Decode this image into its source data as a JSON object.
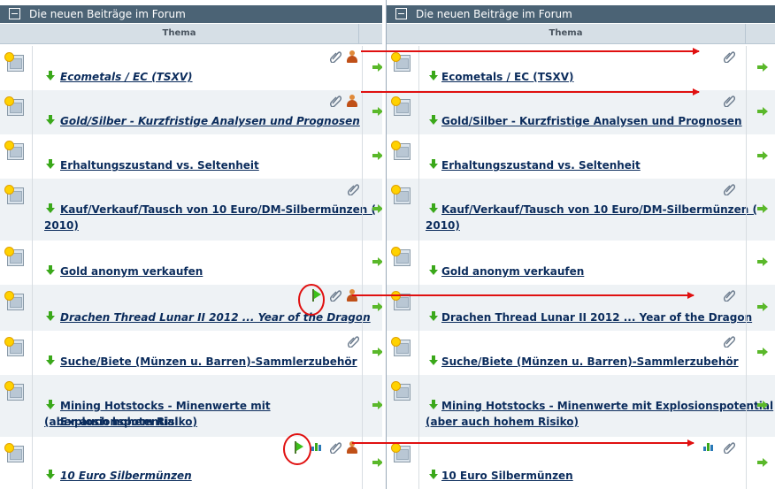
{
  "forum": {
    "header_title": "Die neuen Beiträge im Forum",
    "column_thema": "Thema"
  },
  "rows": [
    {
      "title": "Ecometals / EC (TSXV)",
      "title_line2": ""
    },
    {
      "title": "Gold/Silber - Kurzfristige Analysen und Prognosen",
      "title_line2": ""
    },
    {
      "title": "Erhaltungszustand vs. Seltenheit",
      "title_line2": ""
    },
    {
      "title": "Kauf/Verkauf/Tausch von 10 Euro/DM-Silbermünzen (",
      "title_line2": "2010)"
    },
    {
      "title": "Gold anonym verkaufen",
      "title_line2": ""
    },
    {
      "title": "Drachen Thread Lunar II 2012 ... Year of the Dragon",
      "title_line2": ""
    },
    {
      "title": "Suche/Biete (Münzen u. Barren)-Sammlerzubehör",
      "title_line2": ""
    },
    {
      "title": "Mining Hotstocks - Minenwerte mit Explosionspotential",
      "title_line2": "(aber auch hohem Risiko)"
    },
    {
      "title": "10 Euro Silbermünzen",
      "title_line2": ""
    }
  ],
  "icons": {
    "collapse": "collapse-icon",
    "thread": "thread-icon",
    "new_post": "green-down-arrow-icon",
    "goto": "green-right-arrow-icon",
    "attachment": "paperclip-icon",
    "user": "user-icon",
    "flag": "green-flag-icon",
    "stats": "bar-chart-icon"
  },
  "colors": {
    "header_bg": "#4b6375",
    "link": "#0b2c5c",
    "annotation": "#e01010",
    "alt_row": "#eef2f5"
  }
}
